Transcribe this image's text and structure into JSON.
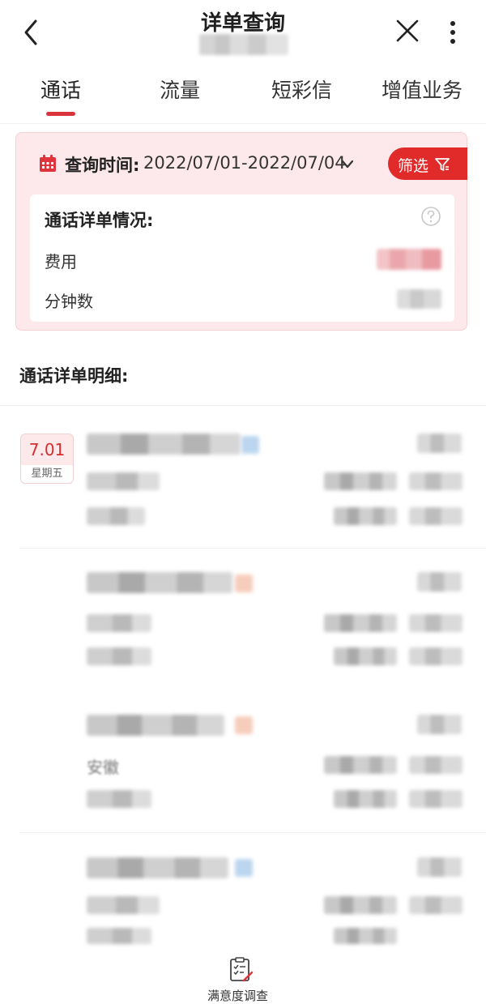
{
  "header": {
    "title": "详单查询",
    "back_icon": "chevron-left-icon",
    "close_icon": "close-icon",
    "more_icon": "more-vertical-icon"
  },
  "tabs": [
    {
      "label": "通话",
      "active": true
    },
    {
      "label": "流量",
      "active": false
    },
    {
      "label": "短彩信",
      "active": false
    },
    {
      "label": "增值业务",
      "active": false
    }
  ],
  "query": {
    "label": "查询时间:",
    "value": "2022/07/01-2022/07/04",
    "filter_label": "筛选",
    "accent_color": "#e12a2a"
  },
  "summary": {
    "title": "通话详单情况:",
    "fee_label": "费用",
    "minutes_label": "分钟数"
  },
  "detail": {
    "title": "通话详单明细:",
    "date": "7.01",
    "weekday": "星期五",
    "partial_texts": [
      "安徽"
    ]
  },
  "footer": {
    "survey_label": "满意度调查"
  }
}
